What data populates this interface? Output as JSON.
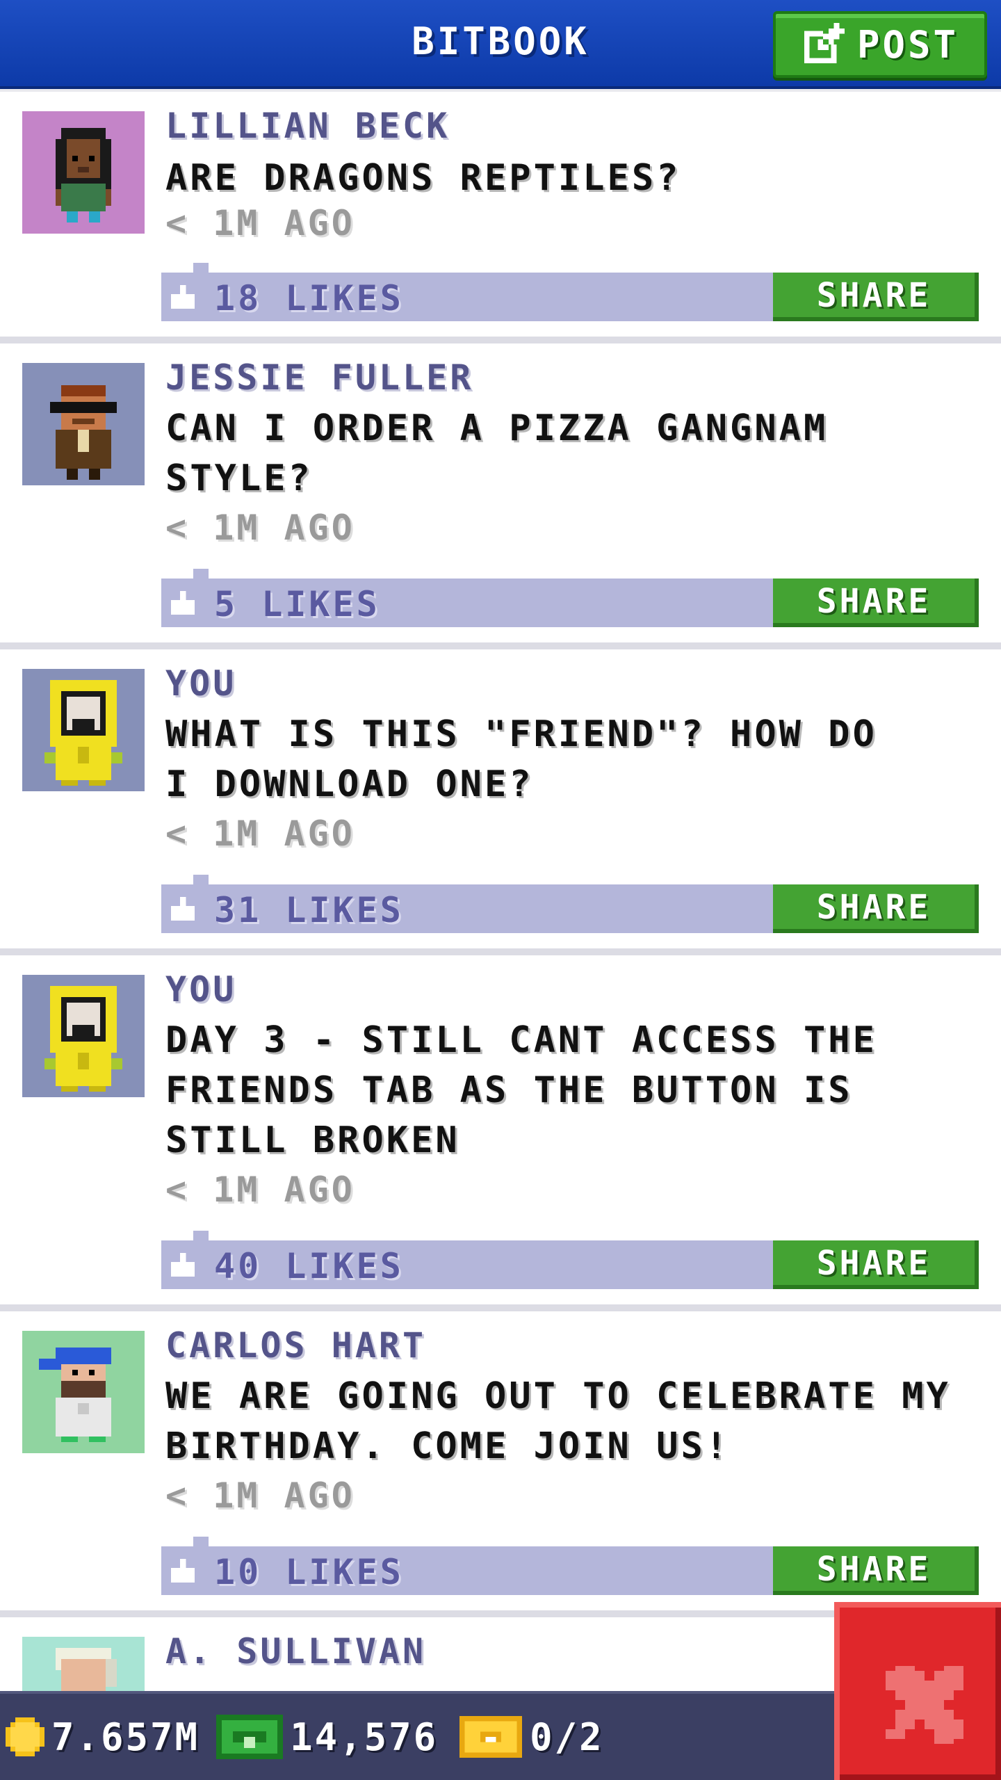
{
  "header": {
    "title": "BITBOOK",
    "post_label": "POST",
    "post_icon": "edit-icon"
  },
  "posts": [
    {
      "author": "LILLIAN BECK",
      "message": "ARE DRAGONS REPTILES?",
      "time": "< 1M AGO",
      "likes": "18 LIKES",
      "share_label": "SHARE",
      "avatar_bg": "#c484c8"
    },
    {
      "author": "JESSIE FULLER",
      "message": "CAN I ORDER A PIZZA GANGNAM STYLE?",
      "time": "< 1M AGO",
      "likes": "5 LIKES",
      "share_label": "SHARE",
      "avatar_bg": "#8690b8"
    },
    {
      "author": "YOU",
      "message": "WHAT IS THIS \"FRIEND\"? HOW DO I DOWNLOAD ONE?",
      "time": "< 1M AGO",
      "likes": "31 LIKES",
      "share_label": "SHARE",
      "avatar_bg": "#8690b8"
    },
    {
      "author": "YOU",
      "message": "DAY 3 - STILL CANT ACCESS THE FRIENDS TAB AS THE BUTTON IS STILL BROKEN",
      "time": "< 1M AGO",
      "likes": "40 LIKES",
      "share_label": "SHARE",
      "avatar_bg": "#8690b8"
    },
    {
      "author": "CARLOS HART",
      "message": "WE ARE GOING OUT TO CELEBRATE MY BIRTHDAY. COME JOIN US!",
      "time": "< 1M AGO",
      "likes": "10 LIKES",
      "share_label": "SHARE",
      "avatar_bg": "#90d4a0"
    },
    {
      "author": "A. SULLIVAN",
      "avatar_bg": "#a8e4d4"
    }
  ],
  "bottom_bar": {
    "coins": "7.657M",
    "bux": "14,576",
    "tickets": "0/2"
  },
  "colors": {
    "header_blue": "#1746b8",
    "post_green": "#3aa52a",
    "like_bar": "#b4b6da",
    "author_purple": "#54548a",
    "close_red": "#e0272b",
    "bottom_bar": "#3b3f63"
  }
}
